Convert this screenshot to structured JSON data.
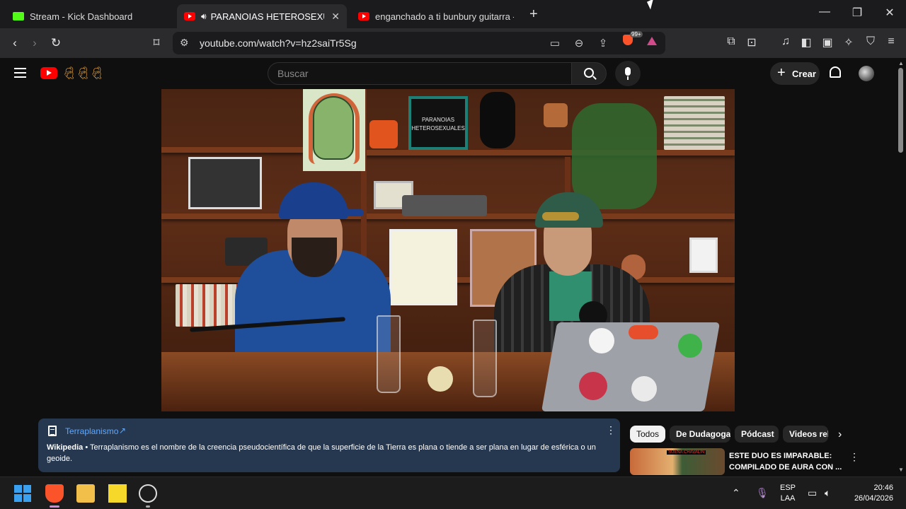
{
  "browser": {
    "tabs": [
      {
        "title": "Stream - Kick Dashboard",
        "favicon": "kick-icon",
        "active": false
      },
      {
        "title": "PARANOIAS HETEROSEXUALES",
        "favicon": "youtube-icon",
        "active": true,
        "audio": true
      },
      {
        "title": "enganchado a ti bunbury guitarra - Y",
        "favicon": "youtube-icon",
        "active": false
      }
    ],
    "new_tab": "+",
    "url": "youtube.com/watch?v=hz2saiTr5Sg",
    "shield_badge": "99+"
  },
  "youtube": {
    "search_placeholder": "Buscar",
    "create_label": "Crear",
    "video": {
      "sign_text": "PARANOIAS HETEROSEXUALES"
    },
    "info_panel": {
      "topic": "Terraplanismo",
      "ext_arrow": "↗",
      "source": "Wikipedia",
      "separator": "•",
      "text": "Terraplanismo es el nombre de la creencia pseudocientífica de que la superficie de la Tierra es plana o tiende a ser plana en lugar de esférica o un geoide."
    },
    "chips": [
      "Todos",
      "De Dudagoga",
      "Pódcast",
      "Videos rela"
    ],
    "related": {
      "title": "ESTE DUO ES IMPARABLE: COMPILADO DE AURA CON ...",
      "thumb_badge": "SUENA CHAVALIN"
    }
  },
  "taskbar": {
    "lang_1": "ESP",
    "lang_2": "LAA",
    "time": "20:46",
    "date": "26/04/2026"
  },
  "colors": {
    "yt_red": "#ff0000",
    "info_bg": "#263850",
    "link_blue": "#5ea8ff",
    "kick_green": "#53fc18"
  }
}
